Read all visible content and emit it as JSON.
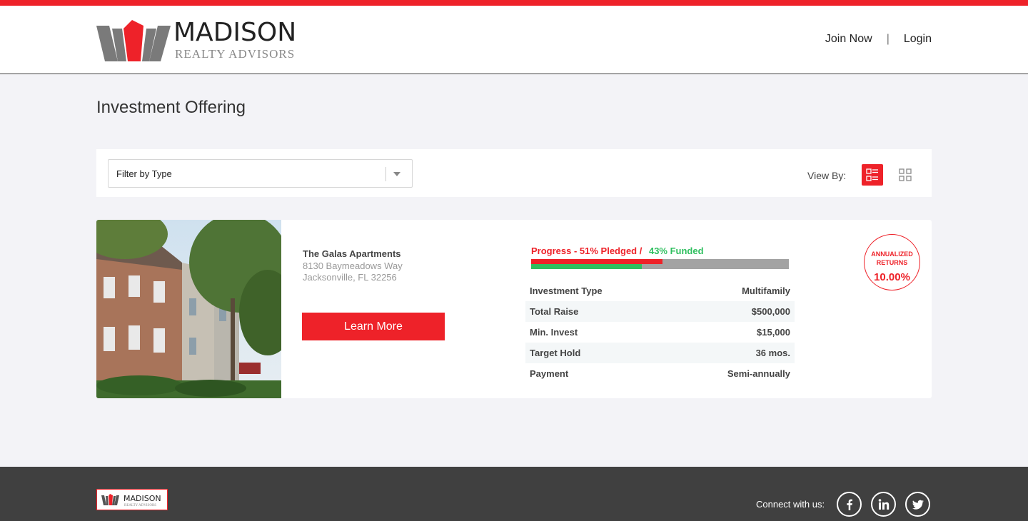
{
  "header": {
    "logo_name": "MADISON",
    "logo_sub": "REALTY ADVISORS",
    "nav": {
      "join": "Join Now",
      "separator": "|",
      "login": "Login"
    }
  },
  "page": {
    "title": "Investment Offering"
  },
  "filter": {
    "select_value": "Filter by Type",
    "view_by_label": "View By:",
    "view_modes": [
      "list-view-icon",
      "grid-view-icon"
    ],
    "active_view": "list"
  },
  "offering": {
    "name": "The Galas Apartments",
    "address": "8130 Baymeadows Way",
    "city": "Jacksonville, FL 32256",
    "learn_more": "Learn More",
    "progress": {
      "pledged_label": "Progress - 51% Pledged /",
      "funded_label": "43% Funded",
      "pledged_percent": 51,
      "funded_percent": 43
    },
    "terms": [
      {
        "label": "Investment Type",
        "value": "Multifamily"
      },
      {
        "label": "Total Raise",
        "value": "$500,000"
      },
      {
        "label": "Min. Invest",
        "value": "$15,000"
      },
      {
        "label": "Target Hold",
        "value": "36 mos."
      },
      {
        "label": "Payment",
        "value": "Semi-annually"
      }
    ],
    "badge": {
      "line1": "ANNUALIZED",
      "line2": "RETURNS",
      "value": "10.00%"
    }
  },
  "footer": {
    "connect_label": "Connect with us:",
    "social": [
      "facebook-icon",
      "linkedin-icon",
      "twitter-icon"
    ]
  },
  "colors": {
    "brand_red": "#ee2229",
    "funded_green": "#2fbf5f",
    "footer_bg": "#404040",
    "page_bg": "#f3f3f7"
  }
}
